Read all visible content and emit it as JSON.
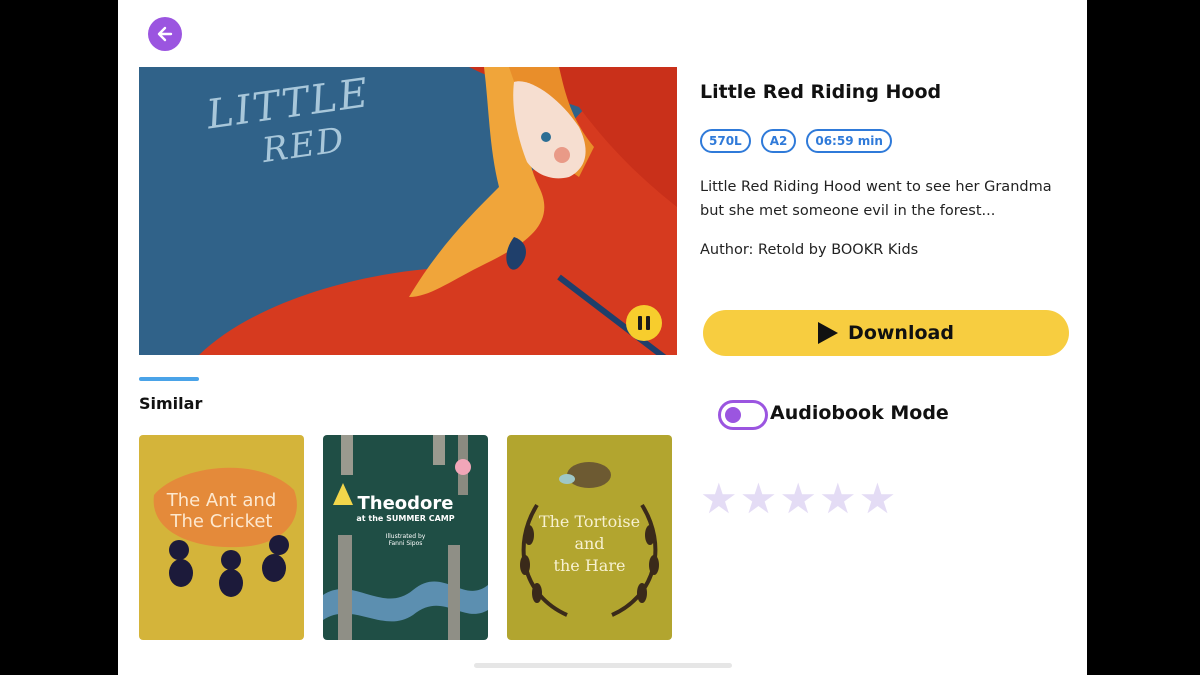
{
  "book": {
    "title": "Little Red Riding Hood",
    "badges": [
      "570L",
      "A2",
      "06:59 min"
    ],
    "description": "Little Red Riding Hood went to see her Grandma but she met someone evil in the forest...",
    "author": "Author:  Retold by BOOKR Kids",
    "cover_text_line1": "LITTLE",
    "cover_text_line2": "RED"
  },
  "actions": {
    "download_label": "Download",
    "audiobook_label": "Audiobook Mode",
    "audiobook_on": true
  },
  "rating": {
    "max": 5,
    "filled": 0
  },
  "similar": {
    "heading": "Similar",
    "books": [
      {
        "title_line1": "The Ant and",
        "title_line2": "The Cricket"
      },
      {
        "title_line1": "Theodore",
        "title_line2": "at the SUMMER CAMP",
        "title_line3": "Illustrated by",
        "title_line4": "Fanni Sipos"
      },
      {
        "title_line1": "The Tortoise",
        "title_line2": "and",
        "title_line3": "the Hare"
      }
    ]
  },
  "colors": {
    "accent_purple": "#9b55e0",
    "download_yellow": "#f7cd40",
    "badge_blue": "#2f7ad9",
    "star_empty": "#e4dcf5"
  },
  "icons": {
    "back": "arrow-left-icon",
    "pause": "pause-icon",
    "play": "play-icon",
    "star": "star-icon"
  }
}
